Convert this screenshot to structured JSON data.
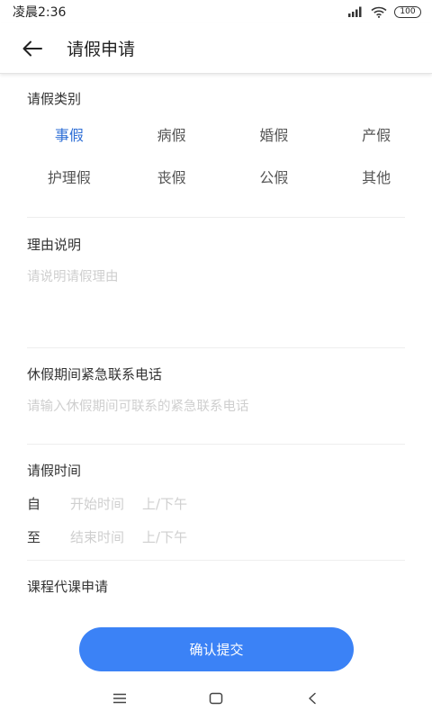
{
  "status_bar": {
    "time": "凌晨2:36",
    "battery": "100"
  },
  "header": {
    "title": "请假申请"
  },
  "leave_type": {
    "label": "请假类别",
    "options": [
      "事假",
      "病假",
      "婚假",
      "产假",
      "护理假",
      "丧假",
      "公假",
      "其他"
    ],
    "selected": "事假"
  },
  "reason": {
    "label": "理由说明",
    "placeholder": "请说明请假理由",
    "value": ""
  },
  "emergency_phone": {
    "label": "休假期间紧急联系电话",
    "placeholder": "请输入休假期间可联系的紧急联系电话",
    "value": ""
  },
  "leave_time": {
    "label": "请假时间",
    "from_label": "自",
    "to_label": "至",
    "start_placeholder": "开始时间",
    "end_placeholder": "结束时间",
    "ampm_placeholder": "上/下午"
  },
  "course_substitute": {
    "label": "课程代课申请"
  },
  "submit": {
    "label": "确认提交"
  },
  "colors": {
    "accent": "#3b82f6",
    "selected_text": "#2f6fd6",
    "placeholder": "#cfcfcf"
  }
}
